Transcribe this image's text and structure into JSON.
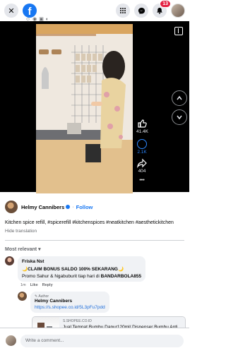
{
  "topbar": {
    "logo": "f",
    "notification_count": "13"
  },
  "video": {
    "actions": {
      "likes": "41.4K",
      "comments": "2.1K",
      "shares": "404",
      "more": "•••"
    }
  },
  "post": {
    "author": "Helmy Cannibers",
    "follow_label": "Follow",
    "caption": "Kitchen spice refill, #spicerefill #kitchenspices #neatkitchen #aesthetickitchen",
    "hide_translation": "Hide translation",
    "sort_label": "Most relevant"
  },
  "comments": [
    {
      "name": "Friska Nst",
      "line1": "🌙CLAIM BONUS SALDO 100% SEKARANG🌙",
      "line2_prefix": "Promo Sahur & Ngabuburit tiap hari di ",
      "line2_bold": "BANDARBOLA855",
      "time": "1m",
      "like": "Like",
      "reply": "Reply"
    }
  ],
  "reply": {
    "tag": "Author",
    "name": "Helmy Cannibers",
    "link": "https://s.shopee.co.id/5L3pFu7pdd",
    "preview": {
      "domain": "S.SHOPEE.CO.ID",
      "title": "Jual Tempat Bumbu Dapur120ml/ Dispenser Bumbu Anti Tumpah/Tempat Bumbu Dapur Murah/Tempat..."
    }
  },
  "composer": {
    "placeholder": "Write a comment..."
  },
  "colors": {
    "brand": "#1877f2",
    "badge": "#e41e3f",
    "link": "#216fdb"
  }
}
